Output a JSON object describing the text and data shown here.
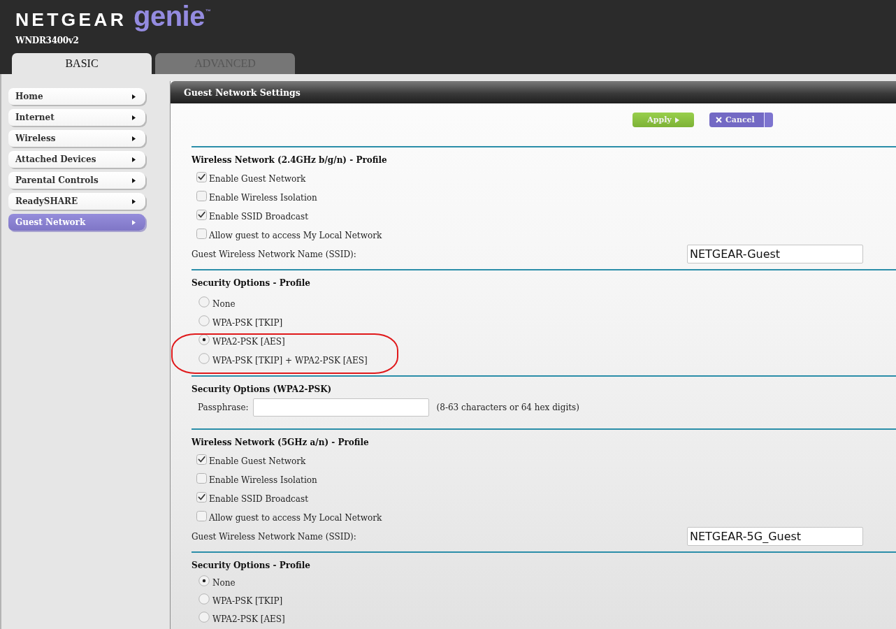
{
  "header": {
    "logo": {
      "brand": "NETGEAR",
      "product": "genie",
      "product_mark": "™"
    },
    "model": "WNDR3400v2",
    "tabs": [
      {
        "label": "BASIC",
        "selected": true
      },
      {
        "label": "ADVANCED",
        "selected": false
      }
    ]
  },
  "sidebar": {
    "items": [
      {
        "label": "Home",
        "selected": false
      },
      {
        "label": "Internet",
        "selected": false
      },
      {
        "label": "Wireless",
        "selected": false
      },
      {
        "label": "Attached Devices",
        "selected": false
      },
      {
        "label": "Parental Controls",
        "selected": false
      },
      {
        "label": "ReadySHARE",
        "selected": false
      },
      {
        "label": "Guest Network",
        "selected": true
      }
    ]
  },
  "panel": {
    "title": "Guest Network Settings",
    "buttons": [
      {
        "label": "Apply",
        "kind": "apply"
      },
      {
        "label": "Cancel",
        "kind": "cancel"
      }
    ],
    "sections": [
      {
        "kind": "profile",
        "heading": "Wireless Network (2.4GHz b/g/n) - Profile",
        "options": [
          {
            "label": "Enable Guest Network",
            "checked": true
          },
          {
            "label": "Enable Wireless Isolation",
            "checked": false
          },
          {
            "label": "Enable SSID Broadcast",
            "checked": true
          },
          {
            "label": "Allow guest to access My Local Network",
            "checked": false
          }
        ],
        "ssid": {
          "label": "Guest Wireless Network Name (SSID):",
          "value": "NETGEAR-Guest"
        }
      },
      {
        "kind": "security",
        "heading": "Security Options - Profile",
        "options": [
          {
            "label": "None",
            "selected": false,
            "circled": false
          },
          {
            "label": "WPA-PSK [TKIP]",
            "selected": false,
            "circled": false
          },
          {
            "label": "WPA2-PSK [AES]",
            "selected": true,
            "circled": true
          },
          {
            "label": "WPA-PSK [TKIP] + WPA2-PSK [AES]",
            "selected": false,
            "circled": true
          }
        ]
      },
      {
        "kind": "passphrase",
        "heading": "Security Options (WPA2-PSK)",
        "label": "Passphrase:",
        "hint": "(8-63 characters or 64 hex digits)"
      },
      {
        "kind": "profile",
        "heading": "Wireless Network (5GHz a/n) - Profile",
        "options": [
          {
            "label": "Enable Guest Network",
            "checked": true
          },
          {
            "label": "Enable Wireless Isolation",
            "checked": false
          },
          {
            "label": "Enable SSID Broadcast",
            "checked": true
          },
          {
            "label": "Allow guest to access My Local Network",
            "checked": false
          }
        ],
        "ssid": {
          "label": "Guest Wireless Network Name (SSID):",
          "value": "NETGEAR-5G_Guest"
        }
      },
      {
        "kind": "security",
        "heading": "Security Options - Profile",
        "options": [
          {
            "label": "None",
            "selected": true,
            "circled": false
          },
          {
            "label": "WPA-PSK [TKIP]",
            "selected": false,
            "circled": false
          },
          {
            "label": "WPA2-PSK [AES]",
            "selected": false,
            "circled": false
          }
        ]
      }
    ]
  }
}
